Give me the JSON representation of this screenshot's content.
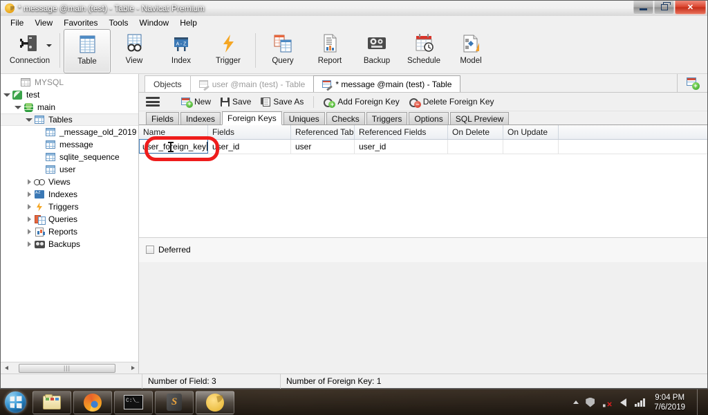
{
  "window": {
    "title": "* message @main (test) - Table - Navicat Premium",
    "app_icon": "navicat-icon",
    "controls": {
      "minimize": "minimize",
      "restore": "restore",
      "close": "close"
    }
  },
  "menubar": {
    "items": [
      "File",
      "View",
      "Favorites",
      "Tools",
      "Window",
      "Help"
    ]
  },
  "ribbon": {
    "buttons": [
      {
        "label": "Connection",
        "icon": "connection-icon",
        "active": false,
        "dropdown": true
      },
      {
        "label": "Table",
        "icon": "table-icon",
        "active": true
      },
      {
        "label": "View",
        "icon": "view-icon",
        "active": false
      },
      {
        "label": "Index",
        "icon": "index-icon",
        "active": false
      },
      {
        "label": "Trigger",
        "icon": "trigger-icon",
        "active": false
      },
      {
        "label": "Query",
        "icon": "query-icon",
        "active": false
      },
      {
        "label": "Report",
        "icon": "report-icon",
        "active": false
      },
      {
        "label": "Backup",
        "icon": "backup-icon",
        "active": false
      },
      {
        "label": "Schedule",
        "icon": "schedule-icon",
        "active": false
      },
      {
        "label": "Model",
        "icon": "model-icon",
        "active": false
      }
    ]
  },
  "sidebar": {
    "items": [
      {
        "label": "MYSQL",
        "icon": "connection-grey-icon",
        "indent": 0,
        "twisty": "none",
        "dim": true,
        "selected": false
      },
      {
        "label": "test",
        "icon": "sqlite-leaf-icon",
        "indent": 0,
        "twisty": "open",
        "dim": false,
        "selected": false
      },
      {
        "label": "main",
        "icon": "database-icon",
        "indent": 1,
        "twisty": "open",
        "dim": false,
        "selected": false
      },
      {
        "label": "Tables",
        "icon": "tables-icon",
        "indent": 2,
        "twisty": "open",
        "dim": false,
        "selected": true
      },
      {
        "label": "_message_old_2019",
        "icon": "table-icon",
        "indent": 4,
        "twisty": "none",
        "dim": false,
        "selected": false
      },
      {
        "label": "message",
        "icon": "table-icon",
        "indent": 4,
        "twisty": "none",
        "dim": false,
        "selected": false
      },
      {
        "label": "sqlite_sequence",
        "icon": "table-icon",
        "indent": 4,
        "twisty": "none",
        "dim": false,
        "selected": false
      },
      {
        "label": "user",
        "icon": "table-icon",
        "indent": 4,
        "twisty": "none",
        "dim": false,
        "selected": false
      },
      {
        "label": "Views",
        "icon": "views-icon",
        "indent": 2,
        "twisty": "closed",
        "dim": false,
        "selected": false
      },
      {
        "label": "Indexes",
        "icon": "indexes-icon",
        "indent": 2,
        "twisty": "closed",
        "dim": false,
        "selected": false
      },
      {
        "label": "Triggers",
        "icon": "triggers-icon",
        "indent": 2,
        "twisty": "closed",
        "dim": false,
        "selected": false
      },
      {
        "label": "Queries",
        "icon": "queries-icon",
        "indent": 2,
        "twisty": "closed",
        "dim": false,
        "selected": false
      },
      {
        "label": "Reports",
        "icon": "reports-icon",
        "indent": 2,
        "twisty": "closed",
        "dim": false,
        "selected": false
      },
      {
        "label": "Backups",
        "icon": "backups-icon",
        "indent": 2,
        "twisty": "closed",
        "dim": false,
        "selected": false
      }
    ],
    "scrollbar": {
      "left_arrow": "◀",
      "right_arrow": "▶",
      "thumb_grip": "|||"
    }
  },
  "tabstrip": {
    "tabs": [
      {
        "label": "Objects",
        "icon": null,
        "state": "inactive"
      },
      {
        "label": "user @main (test) - Table",
        "icon": "table-edit-icon",
        "state": "inactive"
      },
      {
        "label": "* message @main (test) - Table",
        "icon": "table-edit-icon",
        "state": "active"
      }
    ],
    "new_object_button": "new-object-icon"
  },
  "actionbar": {
    "menu_icon": "hamburger-icon",
    "buttons": [
      {
        "label": "New",
        "icon": "new-icon"
      },
      {
        "label": "Save",
        "icon": "save-icon"
      },
      {
        "label": "Save As",
        "icon": "save-as-icon"
      },
      {
        "label": "Add Foreign Key",
        "icon": "add-foreign-key-icon"
      },
      {
        "label": "Delete Foreign Key",
        "icon": "delete-foreign-key-icon"
      }
    ]
  },
  "subtabs": {
    "items": [
      "Fields",
      "Indexes",
      "Foreign Keys",
      "Uniques",
      "Checks",
      "Triggers",
      "Options",
      "SQL Preview"
    ],
    "active": "Foreign Keys"
  },
  "grid": {
    "columns": [
      {
        "label": "Name",
        "width": 100
      },
      {
        "label": "Fields",
        "width": 120
      },
      {
        "label": "Referenced Tabl",
        "width": 92
      },
      {
        "label": "Referenced Fields",
        "width": 135
      },
      {
        "label": "On Delete",
        "width": 80
      },
      {
        "label": "On Update",
        "width": 80
      }
    ],
    "rows": [
      {
        "name": "user_foreign_key",
        "name_editing": true,
        "fields": "user_id",
        "referenced_table": "user",
        "referenced_fields": "user_id",
        "on_delete": "",
        "on_update": ""
      }
    ]
  },
  "annotation": {
    "shape": "rounded-rect",
    "color": "#ee1c1c",
    "target": "name-cell-editor"
  },
  "deferred": {
    "label": "Deferred",
    "checked": false
  },
  "statusbar": {
    "left": "",
    "field_count": "Number of Field: 3",
    "foreign_key_count": "Number of Foreign Key: 1"
  },
  "taskbar": {
    "start": "start-orb-icon",
    "buttons": [
      {
        "name": "explorer",
        "icon": "folder-icon",
        "active": false
      },
      {
        "name": "firefox",
        "icon": "firefox-icon",
        "active": false
      },
      {
        "name": "command-prompt",
        "icon": "cmd-icon",
        "active": false
      },
      {
        "name": "sublime-text",
        "icon": "sublime-icon",
        "active": false
      },
      {
        "name": "navicat",
        "icon": "navicat-icon",
        "active": true
      }
    ],
    "tray": [
      "show-hidden-icons",
      "security-shield-icon",
      "network-disconnected-icon",
      "volume-icon",
      "signal-icon"
    ],
    "clock": {
      "time": "9:04 PM",
      "date": "7/6/2019"
    }
  }
}
